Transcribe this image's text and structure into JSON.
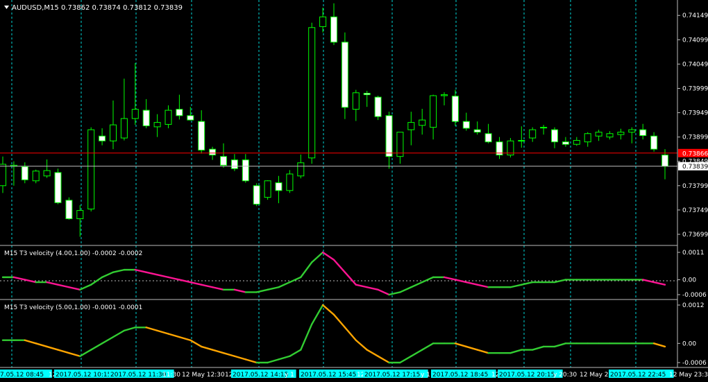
{
  "window": {
    "symbol_title": "AUDUSD,M15",
    "ohlc": "0.73862 0.73874 0.73812 0.73839",
    "menu_arrow": "triangle-down-icon"
  },
  "colors": {
    "background": "#000000",
    "candle_bull_fill": "#000000",
    "candle_bear_fill": "#ffffff",
    "candle_outline": "#00ff00",
    "grid": "#00d8d8",
    "ask_line": "#ff0000",
    "bid_line": "#c0c0c0",
    "t3_rising": "#32cd32",
    "t3_falling_1": "#ff1493",
    "t3_falling_2": "#ffa500",
    "time_label_bg": "#00ffff"
  },
  "price_axis": {
    "ticks": [
      "0.74149",
      "0.74099",
      "0.74049",
      "0.73999",
      "0.73949",
      "0.73899",
      "0.73849",
      "0.73799",
      "0.73749",
      "0.73699"
    ],
    "ask_price": "0.73866",
    "bid_price": "0.73839"
  },
  "indicator1": {
    "label": "M15 T3 velocity (4.00,1.00) -0.0002 -0.0002",
    "ticks": [
      "0.0011",
      "0.00",
      "-0.0006"
    ]
  },
  "indicator2": {
    "label": "M15 T3 velocity (5.00,1.00) -0.0001 -0.0001",
    "ticks": [
      "0.0012",
      "0.00",
      "-0.0006"
    ]
  },
  "time_axis": [
    {
      "text": "7.05.12 08:45",
      "highlight": true
    },
    {
      "text": "12",
      "highlight": false
    },
    {
      "text": "2017.05.12 10:15",
      "highlight": true
    },
    {
      "text": "2017.05.12 11:30",
      "highlight": true
    },
    {
      "text": "11:30",
      "highlight": false
    },
    {
      "text": "12 May 12:30",
      "highlight": false
    },
    {
      "text": "12",
      "highlight": false
    },
    {
      "text": "2017.05.12 14:15",
      "highlight": true
    },
    {
      "text": "y 1",
      "highlight": false
    },
    {
      "text": "2017.05.12 15:45",
      "highlight": true
    },
    {
      "text": "12",
      "highlight": false
    },
    {
      "text": "2017.05.12 17:15",
      "highlight": true
    },
    {
      "text": "y 1",
      "highlight": false
    },
    {
      "text": "2017.05.12 18:45",
      "highlight": true
    },
    {
      "text": "12",
      "highlight": false
    },
    {
      "text": "2017.05.12 20:15",
      "highlight": true
    },
    {
      "text": "y 20:30",
      "highlight": false
    },
    {
      "text": "12 May 2",
      "highlight": false
    },
    {
      "text": "2017.05.12 22:45",
      "highlight": true
    },
    {
      "text": "12 May 23:30",
      "highlight": false
    }
  ],
  "chart_data": {
    "type": "candlestick",
    "symbol": "AUDUSD",
    "timeframe": "M15",
    "candles": [
      {
        "o": 0.73799,
        "h": 0.73859,
        "l": 0.73784,
        "c": 0.73843
      },
      {
        "o": 0.73839,
        "h": 0.73849,
        "l": 0.73799,
        "c": 0.73841
      },
      {
        "o": 0.73838,
        "h": 0.73847,
        "l": 0.73804,
        "c": 0.73811
      },
      {
        "o": 0.73809,
        "h": 0.73832,
        "l": 0.73804,
        "c": 0.73829
      },
      {
        "o": 0.73819,
        "h": 0.73853,
        "l": 0.73815,
        "c": 0.7383
      },
      {
        "o": 0.73826,
        "h": 0.73834,
        "l": 0.73761,
        "c": 0.73764
      },
      {
        "o": 0.73769,
        "h": 0.73775,
        "l": 0.73729,
        "c": 0.73731
      },
      {
        "o": 0.73731,
        "h": 0.73759,
        "l": 0.73694,
        "c": 0.73748
      },
      {
        "o": 0.73751,
        "h": 0.73919,
        "l": 0.73746,
        "c": 0.73914
      },
      {
        "o": 0.73901,
        "h": 0.73917,
        "l": 0.73882,
        "c": 0.73891
      },
      {
        "o": 0.73891,
        "h": 0.73974,
        "l": 0.73874,
        "c": 0.73924
      },
      {
        "o": 0.73897,
        "h": 0.74019,
        "l": 0.73892,
        "c": 0.73937
      },
      {
        "o": 0.73937,
        "h": 0.74051,
        "l": 0.73924,
        "c": 0.73956
      },
      {
        "o": 0.73954,
        "h": 0.73977,
        "l": 0.73917,
        "c": 0.73922
      },
      {
        "o": 0.7392,
        "h": 0.73946,
        "l": 0.73899,
        "c": 0.73929
      },
      {
        "o": 0.73925,
        "h": 0.73964,
        "l": 0.73917,
        "c": 0.73954
      },
      {
        "o": 0.73956,
        "h": 0.73986,
        "l": 0.73935,
        "c": 0.73943
      },
      {
        "o": 0.73943,
        "h": 0.73961,
        "l": 0.73933,
        "c": 0.73934
      },
      {
        "o": 0.73931,
        "h": 0.73954,
        "l": 0.73865,
        "c": 0.73872
      },
      {
        "o": 0.73874,
        "h": 0.73879,
        "l": 0.73852,
        "c": 0.73862
      },
      {
        "o": 0.73859,
        "h": 0.73886,
        "l": 0.73836,
        "c": 0.73841
      },
      {
        "o": 0.73852,
        "h": 0.73864,
        "l": 0.73829,
        "c": 0.73834
      },
      {
        "o": 0.73852,
        "h": 0.73864,
        "l": 0.73805,
        "c": 0.73809
      },
      {
        "o": 0.73799,
        "h": 0.73804,
        "l": 0.73757,
        "c": 0.73761
      },
      {
        "o": 0.73775,
        "h": 0.7381,
        "l": 0.7377,
        "c": 0.73809
      },
      {
        "o": 0.73805,
        "h": 0.73819,
        "l": 0.73763,
        "c": 0.73789
      },
      {
        "o": 0.73789,
        "h": 0.73831,
        "l": 0.73784,
        "c": 0.73823
      },
      {
        "o": 0.73819,
        "h": 0.73863,
        "l": 0.73814,
        "c": 0.73846
      },
      {
        "o": 0.73856,
        "h": 0.74134,
        "l": 0.73844,
        "c": 0.74124
      },
      {
        "o": 0.74126,
        "h": 0.74165,
        "l": 0.74114,
        "c": 0.74146
      },
      {
        "o": 0.74146,
        "h": 0.74174,
        "l": 0.74088,
        "c": 0.74094
      },
      {
        "o": 0.74094,
        "h": 0.74114,
        "l": 0.73936,
        "c": 0.7396
      },
      {
        "o": 0.73956,
        "h": 0.73996,
        "l": 0.73932,
        "c": 0.7399
      },
      {
        "o": 0.73989,
        "h": 0.73994,
        "l": 0.73961,
        "c": 0.73986
      },
      {
        "o": 0.73981,
        "h": 0.73984,
        "l": 0.73934,
        "c": 0.73941
      },
      {
        "o": 0.73943,
        "h": 0.73951,
        "l": 0.73834,
        "c": 0.73859
      },
      {
        "o": 0.73859,
        "h": 0.73889,
        "l": 0.73844,
        "c": 0.73909
      },
      {
        "o": 0.73914,
        "h": 0.73951,
        "l": 0.73882,
        "c": 0.73929
      },
      {
        "o": 0.73923,
        "h": 0.73957,
        "l": 0.73904,
        "c": 0.73934
      },
      {
        "o": 0.73919,
        "h": 0.73986,
        "l": 0.73894,
        "c": 0.73984
      },
      {
        "o": 0.73984,
        "h": 0.73991,
        "l": 0.73964,
        "c": 0.73986
      },
      {
        "o": 0.73983,
        "h": 0.73996,
        "l": 0.73922,
        "c": 0.73931
      },
      {
        "o": 0.73931,
        "h": 0.73949,
        "l": 0.73912,
        "c": 0.73917
      },
      {
        "o": 0.73914,
        "h": 0.73931,
        "l": 0.73904,
        "c": 0.73909
      },
      {
        "o": 0.73906,
        "h": 0.73926,
        "l": 0.73886,
        "c": 0.73889
      },
      {
        "o": 0.73889,
        "h": 0.73899,
        "l": 0.73854,
        "c": 0.73862
      },
      {
        "o": 0.73862,
        "h": 0.73897,
        "l": 0.73857,
        "c": 0.73891
      },
      {
        "o": 0.73892,
        "h": 0.73921,
        "l": 0.73877,
        "c": 0.73892
      },
      {
        "o": 0.73897,
        "h": 0.73919,
        "l": 0.73889,
        "c": 0.73914
      },
      {
        "o": 0.73919,
        "h": 0.73924,
        "l": 0.73904,
        "c": 0.73918
      },
      {
        "o": 0.73914,
        "h": 0.73919,
        "l": 0.73876,
        "c": 0.73889
      },
      {
        "o": 0.73889,
        "h": 0.73899,
        "l": 0.73879,
        "c": 0.73884
      },
      {
        "o": 0.73884,
        "h": 0.73899,
        "l": 0.73881,
        "c": 0.73892
      },
      {
        "o": 0.73889,
        "h": 0.73909,
        "l": 0.73879,
        "c": 0.73906
      },
      {
        "o": 0.73901,
        "h": 0.73914,
        "l": 0.73891,
        "c": 0.73909
      },
      {
        "o": 0.73899,
        "h": 0.73911,
        "l": 0.73894,
        "c": 0.73906
      },
      {
        "o": 0.73904,
        "h": 0.73916,
        "l": 0.73894,
        "c": 0.73909
      },
      {
        "o": 0.73909,
        "h": 0.73919,
        "l": 0.73886,
        "c": 0.73914
      },
      {
        "o": 0.73914,
        "h": 0.73926,
        "l": 0.73894,
        "c": 0.73902
      },
      {
        "o": 0.73901,
        "h": 0.73909,
        "l": 0.73869,
        "c": 0.73874
      },
      {
        "o": 0.73862,
        "h": 0.73874,
        "l": 0.73812,
        "c": 0.73839
      }
    ],
    "t3_velocity_4": [
      0.0001,
      0.0001,
      0.0,
      -0.0001,
      -0.0001,
      -0.0002,
      -0.0003,
      -0.0004,
      -0.0002,
      0.0001,
      0.0003,
      0.0004,
      0.0004,
      0.0003,
      0.0002,
      0.0001,
      0.0,
      -0.0001,
      -0.0002,
      -0.0003,
      -0.0004,
      -0.0004,
      -0.0005,
      -0.0005,
      -0.0004,
      -0.0003,
      -0.0001,
      0.0001,
      0.0007,
      0.0011,
      0.0008,
      0.0003,
      -0.0002,
      -0.0003,
      -0.0004,
      -0.0006,
      -0.0005,
      -0.0003,
      -0.0001,
      0.0001,
      0.0001,
      0.0,
      -0.0001,
      -0.0002,
      -0.0003,
      -0.0003,
      -0.0003,
      -0.0002,
      -0.0001,
      -0.0001,
      -0.0001,
      0.0,
      0.0,
      0.0,
      0.0,
      0.0,
      0.0,
      0.0,
      0.0,
      -0.0001,
      -0.0002
    ],
    "t3_velocity_5": [
      0.0001,
      0.0001,
      0.0001,
      0.0,
      -0.0001,
      -0.0002,
      -0.0003,
      -0.0004,
      -0.0002,
      0.0,
      0.0002,
      0.0004,
      0.0005,
      0.0005,
      0.0004,
      0.0003,
      0.0002,
      0.0001,
      -0.0001,
      -0.0002,
      -0.0003,
      -0.0004,
      -0.0005,
      -0.0006,
      -0.0006,
      -0.0005,
      -0.0004,
      -0.0002,
      0.0006,
      0.0012,
      0.0009,
      0.0005,
      0.0001,
      -0.0002,
      -0.0004,
      -0.0006,
      -0.0006,
      -0.0004,
      -0.0002,
      0.0,
      0.0,
      0.0,
      -0.0001,
      -0.0002,
      -0.0003,
      -0.0003,
      -0.0003,
      -0.0002,
      -0.0002,
      -0.0001,
      -0.0001,
      0.0,
      0.0,
      0.0,
      0.0,
      0.0,
      0.0,
      0.0,
      0.0,
      0.0,
      -0.0001
    ],
    "ylim": [
      0.73679,
      0.74175
    ]
  }
}
